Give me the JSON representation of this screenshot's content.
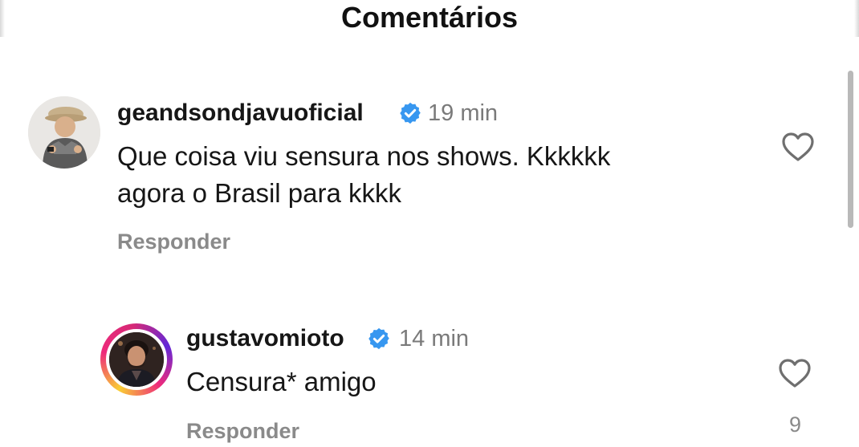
{
  "header": {
    "title": "Comentários"
  },
  "comments": [
    {
      "username": "geandsondjavuoficial",
      "verified": true,
      "time": "19 min",
      "text_lines": [
        "Que coisa viu sensura nos shows. Kkkkkk",
        "agora o Brasil para kkkk"
      ],
      "reply_label": "Responder",
      "like_count": ""
    },
    {
      "username": "gustavomioto",
      "verified": true,
      "time": "14 min",
      "text_lines": [
        "Censura* amigo"
      ],
      "reply_label": "Responder",
      "like_count": "9"
    }
  ],
  "colors": {
    "verified_badge": "#3797f0",
    "muted_text": "#8a8a8a",
    "primary_text": "#161616",
    "story_ring": [
      "#f9ce34",
      "#ee2a7b",
      "#6228d7"
    ]
  },
  "icons": {
    "verified": "verified-badge-icon",
    "like": "heart-outline-icon"
  }
}
